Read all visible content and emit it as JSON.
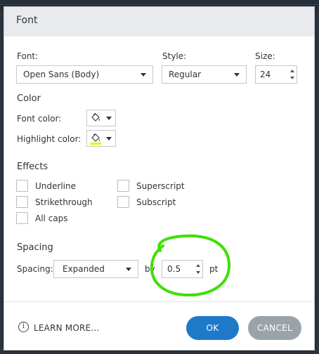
{
  "dialog": {
    "title": "Font"
  },
  "font_section": {
    "font_label": "Font:",
    "font_value": "Open Sans (Body)",
    "style_label": "Style:",
    "style_value": "Regular",
    "size_label": "Size:",
    "size_value": "24"
  },
  "color_section": {
    "heading": "Color",
    "font_color_label": "Font color:",
    "highlight_color_label": "Highlight color:",
    "font_color_icon": "paint-bucket-icon",
    "highlight_color_icon": "paint-bucket-icon",
    "highlight_swatch_color": "#f2ef00"
  },
  "effects_section": {
    "heading": "Effects",
    "options": [
      {
        "label": "Underline",
        "checked": false
      },
      {
        "label": "Strikethrough",
        "checked": false
      },
      {
        "label": "All caps",
        "checked": false
      },
      {
        "label": "Superscript",
        "checked": false
      },
      {
        "label": "Subscript",
        "checked": false
      }
    ]
  },
  "spacing_section": {
    "heading": "Spacing",
    "spacing_label": "Spacing:",
    "spacing_value": "Expanded",
    "by_label": "by",
    "amount_value": "0.5",
    "unit_label": "pt"
  },
  "footer": {
    "learn_more_label": "LEARN MORE...",
    "info_icon": "info-icon",
    "ok_label": "OK",
    "cancel_label": "CANCEL"
  },
  "colors": {
    "ok_button": "#1f79c9",
    "cancel_button": "#9ba3aa",
    "annotation_circle": "#3ee000"
  }
}
